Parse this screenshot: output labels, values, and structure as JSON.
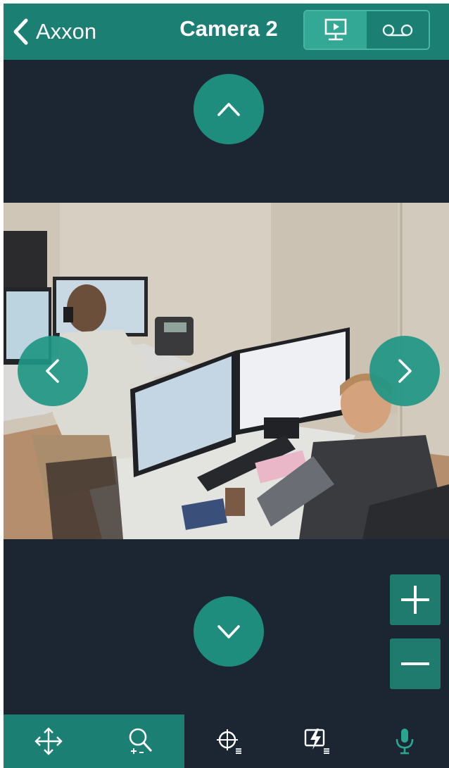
{
  "header": {
    "back_label": "Axxon",
    "title": "Camera 2",
    "modes": [
      {
        "name": "live",
        "active": true
      },
      {
        "name": "archive",
        "active": false
      }
    ]
  },
  "ptz": {
    "up": "chevron-up-icon",
    "down": "chevron-down-icon",
    "left": "chevron-left-icon",
    "right": "chevron-right-icon"
  },
  "zoom": {
    "in": "plus-icon",
    "out": "minus-icon"
  },
  "toolbar": {
    "items": [
      "move-arrows-icon",
      "zoom-magnifier-icon",
      "preset-crosshair-icon",
      "relay-lightning-icon",
      "microphone-icon"
    ],
    "active_section": "ptz-zoom"
  },
  "colors": {
    "header_bg": "#1b7f73",
    "screen_bg": "#1c2633",
    "accent": "#33a894",
    "button": "#209684"
  }
}
